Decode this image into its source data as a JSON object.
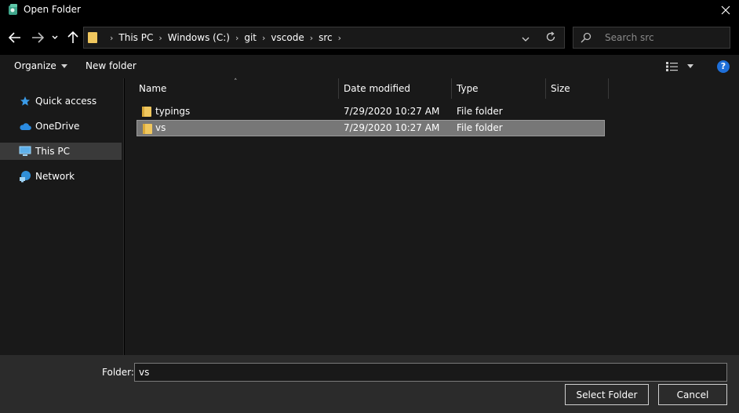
{
  "window": {
    "title": "Open Folder"
  },
  "navigation": {
    "breadcrumbs": [
      "This PC",
      "Windows (C:)",
      "git",
      "vscode",
      "src"
    ],
    "search_placeholder": "Search src"
  },
  "toolbar": {
    "organize_label": "Organize",
    "new_folder_label": "New folder",
    "help_label": "?"
  },
  "sidebar": {
    "items": [
      {
        "label": "Quick access",
        "icon": "star-icon",
        "selected": false
      },
      {
        "label": "OneDrive",
        "icon": "cloud-icon",
        "selected": false
      },
      {
        "label": "This PC",
        "icon": "computer-icon",
        "selected": true
      },
      {
        "label": "Network",
        "icon": "network-icon",
        "selected": false
      }
    ]
  },
  "file_list": {
    "columns": [
      "Name",
      "Date modified",
      "Type",
      "Size"
    ],
    "rows": [
      {
        "name": "typings",
        "date_modified": "7/29/2020 10:27 AM",
        "type": "File folder",
        "size": "",
        "selected": false
      },
      {
        "name": "vs",
        "date_modified": "7/29/2020 10:27 AM",
        "type": "File folder",
        "size": "",
        "selected": true
      }
    ]
  },
  "footer": {
    "folder_label": "Folder:",
    "folder_value": "vs",
    "select_button": "Select Folder",
    "cancel_button": "Cancel"
  },
  "colors": {
    "folder": "#f0c75e",
    "accent": "#1e6fd9",
    "selection": "#777777"
  }
}
